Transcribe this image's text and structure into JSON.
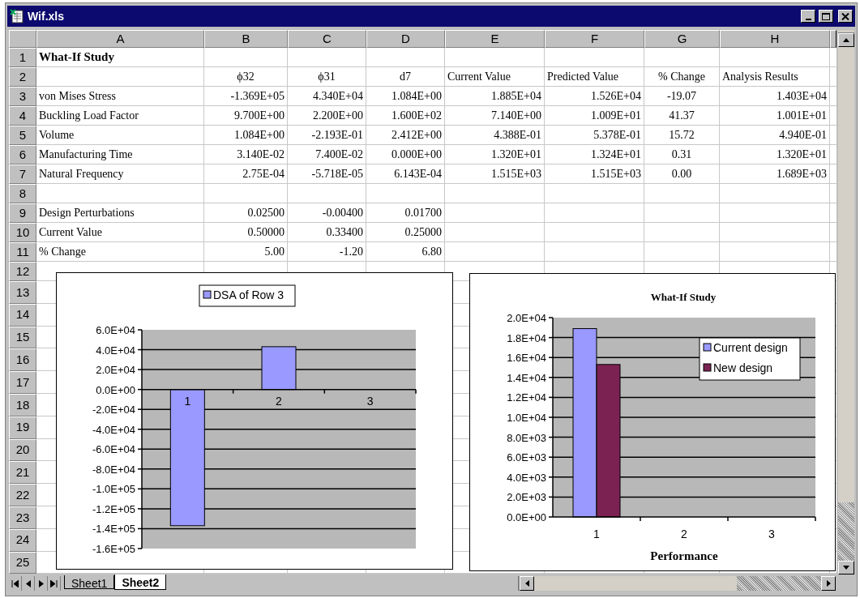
{
  "window": {
    "title": "Wif.xls"
  },
  "columns": [
    "A",
    "B",
    "C",
    "D",
    "E",
    "F",
    "G",
    "H"
  ],
  "rows": [
    {
      "number": "1",
      "kind": "title",
      "cells": [
        "What-If Study"
      ]
    },
    {
      "number": "2",
      "kind": "header",
      "cells": [
        null,
        "ϕ32",
        "ϕ31",
        "d7",
        "Current Value",
        "Predicted Value",
        "% Change",
        "Analysis Results"
      ]
    },
    {
      "number": "3",
      "kind": "data",
      "cells": [
        "von Mises Stress",
        "-1.369E+05",
        "4.340E+04",
        "1.084E+00",
        "1.885E+04",
        "1.526E+04",
        "-19.07",
        "1.403E+04"
      ]
    },
    {
      "number": "4",
      "kind": "data",
      "cells": [
        "Buckling Load Factor",
        "9.700E+00",
        "2.200E+00",
        "1.600E+02",
        "7.140E+00",
        "1.009E+01",
        "41.37",
        "1.001E+01"
      ]
    },
    {
      "number": "5",
      "kind": "data",
      "cells": [
        "Volume",
        "1.084E+00",
        "-2.193E-01",
        "2.412E+00",
        "4.388E-01",
        "5.378E-01",
        "15.72",
        "4.940E-01"
      ]
    },
    {
      "number": "6",
      "kind": "data",
      "cells": [
        "Manufacturing Time",
        "3.140E-02",
        "7.400E-02",
        "0.000E+00",
        "1.320E+01",
        "1.324E+01",
        "0.31",
        "1.320E+01"
      ]
    },
    {
      "number": "7",
      "kind": "data",
      "cells": [
        "Natural Frequency",
        "2.75E-04",
        "-5.718E-05",
        "6.143E-04",
        "1.515E+03",
        "1.515E+03",
        "0.00",
        "1.689E+03"
      ]
    },
    {
      "number": "8"
    },
    {
      "number": "9",
      "kind": "data",
      "cells": [
        "Design Perturbations",
        "0.02500",
        "-0.00400",
        "0.01700"
      ]
    },
    {
      "number": "10",
      "kind": "data",
      "cells": [
        "Current Value",
        "0.50000",
        "0.33400",
        "0.25000"
      ]
    },
    {
      "number": "11",
      "kind": "data",
      "cells": [
        "% Change",
        "5.00",
        "-1.20",
        "6.80"
      ]
    },
    {
      "number": "12"
    },
    {
      "number": "13"
    },
    {
      "number": "14"
    },
    {
      "number": "15"
    },
    {
      "number": "16"
    },
    {
      "number": "17"
    },
    {
      "number": "18"
    },
    {
      "number": "19"
    },
    {
      "number": "20"
    },
    {
      "number": "21"
    },
    {
      "number": "22"
    },
    {
      "number": "23"
    },
    {
      "number": "24"
    },
    {
      "number": "25"
    }
  ],
  "charts": [
    {
      "chart_data": {
        "type": "bar",
        "grid": true,
        "legend": true,
        "categories": [
          "1",
          "2",
          "3"
        ],
        "series": [
          {
            "name": "DSA of Row 3",
            "color": "#9999ff",
            "values": [
              -137000,
              43000,
              0
            ]
          }
        ],
        "ylim": [
          -160000,
          60000
        ],
        "yticks": [
          {
            "value": 60000,
            "label": "6.0E+04"
          },
          {
            "value": 40000,
            "label": "4.0E+04"
          },
          {
            "value": 20000,
            "label": "2.0E+04"
          },
          {
            "value": 0,
            "label": "0.0E+00"
          },
          {
            "value": -20000,
            "label": "-2.0E+04"
          },
          {
            "value": -40000,
            "label": "-4.0E+04"
          },
          {
            "value": -60000,
            "label": "-6.0E+04"
          },
          {
            "value": -80000,
            "label": "-8.0E+04"
          },
          {
            "value": -100000,
            "label": "-1.0E+05"
          },
          {
            "value": -120000,
            "label": "-1.2E+05"
          },
          {
            "value": -140000,
            "label": "-1.4E+05"
          },
          {
            "value": -160000,
            "label": "-1.6E+05"
          }
        ]
      }
    },
    {
      "chart_data": {
        "type": "bar",
        "grid": true,
        "legend": true,
        "title": "What-If Study",
        "xlabel": "Performance",
        "categories": [
          "1",
          "2",
          "3"
        ],
        "series": [
          {
            "name": "Current design",
            "color": "#9999ff",
            "values": [
              18900,
              null,
              null
            ]
          },
          {
            "name": "New design",
            "color": "#7b2252",
            "values": [
              15300,
              null,
              null
            ]
          }
        ],
        "ylim": [
          0,
          20000
        ],
        "yticks": [
          {
            "value": 0,
            "label": "0.0E+00"
          },
          {
            "value": 2000,
            "label": "2.0E+03"
          },
          {
            "value": 4000,
            "label": "4.0E+03"
          },
          {
            "value": 6000,
            "label": "6.0E+03"
          },
          {
            "value": 8000,
            "label": "8.0E+03"
          },
          {
            "value": 10000,
            "label": "1.0E+04"
          },
          {
            "value": 12000,
            "label": "1.2E+04"
          },
          {
            "value": 14000,
            "label": "1.4E+04"
          },
          {
            "value": 16000,
            "label": "1.6E+04"
          },
          {
            "value": 18000,
            "label": "1.8E+04"
          },
          {
            "value": 20000,
            "label": "2.0E+04"
          }
        ]
      }
    }
  ],
  "sheet_tabs": [
    {
      "label": "Sheet1",
      "selected": false
    },
    {
      "label": "Sheet2",
      "selected": true
    }
  ]
}
